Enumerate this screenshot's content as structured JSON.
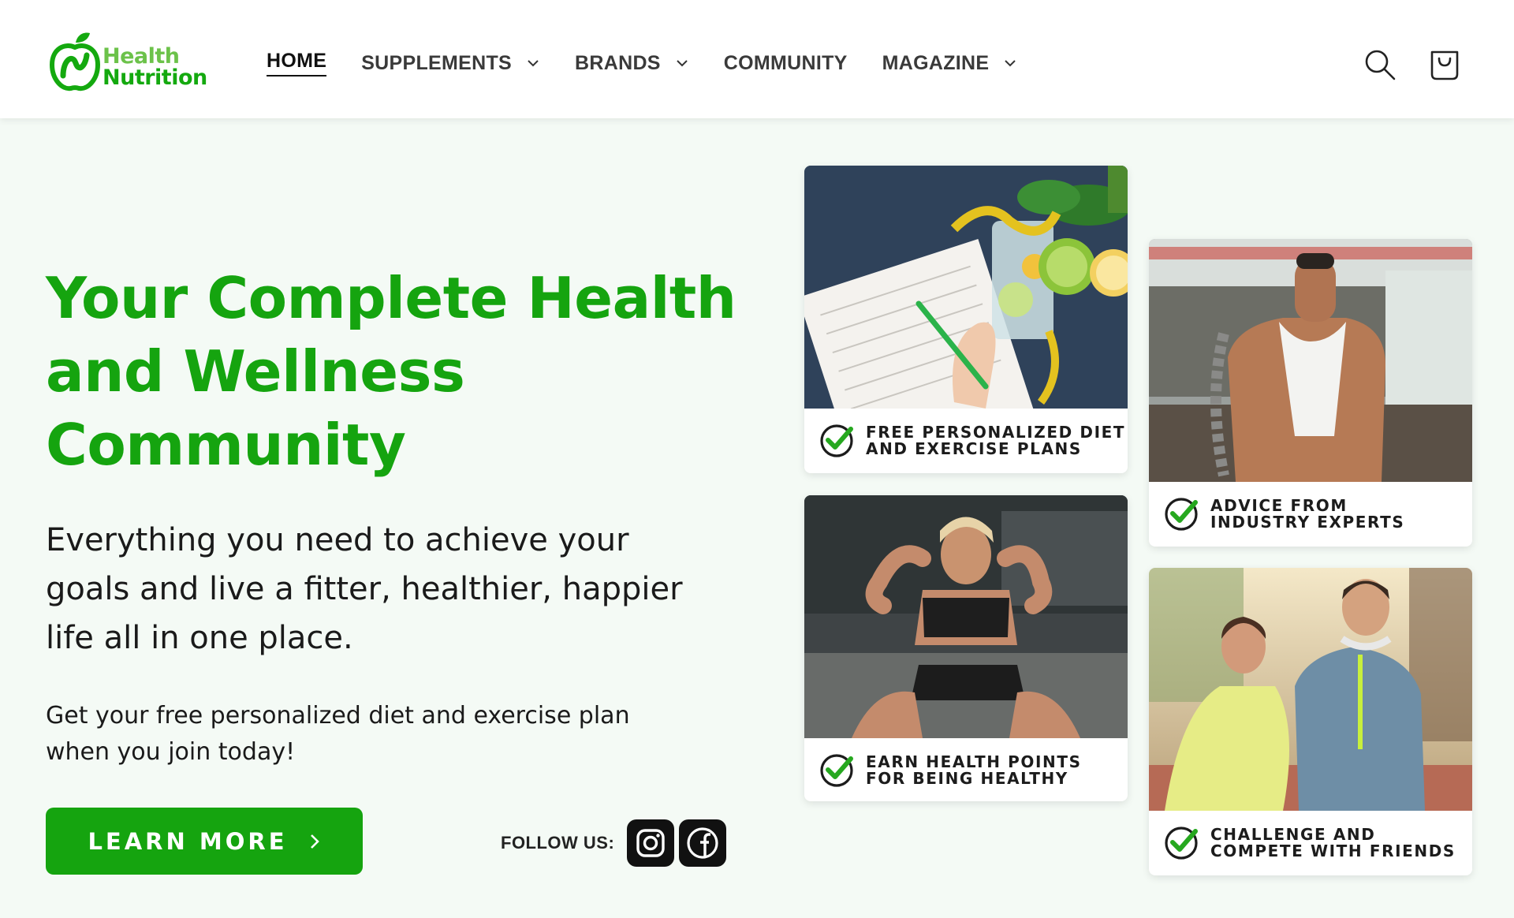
{
  "brand": {
    "line1": "Health",
    "line2": "Nutrition"
  },
  "nav": [
    {
      "label": "HOME",
      "dropdown": false,
      "active": true
    },
    {
      "label": "SUPPLEMENTS",
      "dropdown": true,
      "active": false
    },
    {
      "label": "BRANDS",
      "dropdown": true,
      "active": false
    },
    {
      "label": "COMMUNITY",
      "dropdown": false,
      "active": false
    },
    {
      "label": "MAGAZINE",
      "dropdown": true,
      "active": false
    }
  ],
  "header_icons": {
    "search": "search-icon",
    "cart": "cart-icon"
  },
  "hero": {
    "title_lines": [
      "Your Complete Health",
      "and Wellness",
      "Community"
    ],
    "subtitle_lines": [
      "Everything you need to achieve your",
      "goals and live a fitter, healthier, happier",
      "life all in one place."
    ],
    "note_lines": [
      "Get your free personalized diet and exercise plan",
      "when you join today!"
    ],
    "cta_label": "LEARN MORE",
    "follow_label": "FOLLOW US:",
    "social": [
      "instagram-icon",
      "facebook-icon"
    ]
  },
  "cards": [
    {
      "caption_lines": [
        "FREE PERSONALIZED DIET",
        "AND EXERCISE PLANS"
      ],
      "image": "diet-journal-photo"
    },
    {
      "caption_lines": [
        "ADVICE FROM",
        "INDUSTRY EXPERTS"
      ],
      "image": "gym-trainer-photo"
    },
    {
      "caption_lines": [
        "EARN HEALTH POINTS",
        "FOR BEING HEALTHY"
      ],
      "image": "situps-workout-photo"
    },
    {
      "caption_lines": [
        "CHALLENGE AND",
        "COMPETE WITH FRIENDS"
      ],
      "image": "running-couple-photo"
    }
  ],
  "colors": {
    "accent": "#15a40f",
    "logo_light": "#6cc24a",
    "background": "#f4faf5"
  }
}
